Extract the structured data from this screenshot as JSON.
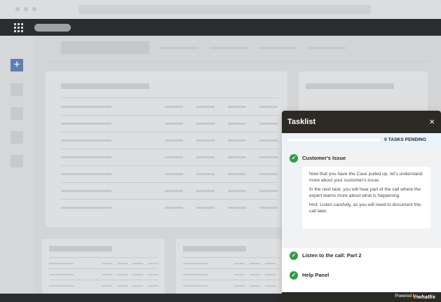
{
  "tasklist": {
    "title": "Tasklist",
    "close_icon": "×",
    "progress": {
      "completed_fraction": 0.0,
      "pending_label": "0 TASKS PENDING"
    },
    "tasks": [
      {
        "label": "Customer's Issue",
        "status": "complete",
        "expanded": true,
        "description": [
          "Now that you have the Case pulled up, let's understand more about your customer's issue.",
          "In the next task, you will hear part of the call where the expert learns more about what is happening.",
          "Hint: Listen carefully, as you will need to document this call later."
        ]
      },
      {
        "label": "Listen to the call: Part 2",
        "status": "complete"
      },
      {
        "label": "Help Panel",
        "status": "complete"
      }
    ],
    "footer": {
      "powered_by": "Powered by",
      "brand": "whatfix"
    }
  },
  "left_rail": {
    "add_icon": "+"
  },
  "colors": {
    "accent_green": "#2e9e45",
    "header_dark": "#2c2a25",
    "brand_orange": "#f37a2a",
    "rail_add_blue": "#5e7fb4"
  }
}
